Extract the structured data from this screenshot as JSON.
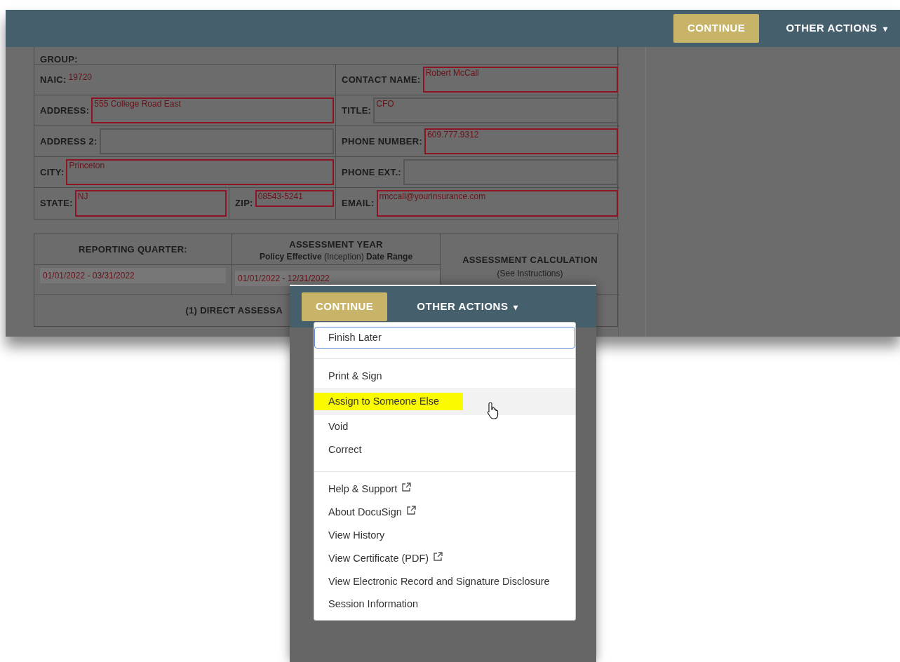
{
  "header": {
    "continue_button": "CONTINUE",
    "other_actions": "OTHER ACTIONS",
    "caret": "▾"
  },
  "contact_form": {
    "group_label": "GROUP:",
    "left": [
      {
        "kind": "text",
        "label": "NAIC:",
        "value": "19720"
      },
      {
        "kind": "field",
        "label": "ADDRESS:",
        "value": "555 College Road East",
        "required": true
      },
      {
        "kind": "field",
        "label": "ADDRESS 2:",
        "required": false
      },
      {
        "kind": "field",
        "label": "CITY:",
        "value": "Princeton",
        "required": true
      },
      {
        "kind": "pair",
        "label": "STATE:",
        "value": "NJ",
        "required": true,
        "label_2": "ZIP:",
        "value_2": "08543-5241",
        "required_2": true
      }
    ],
    "right": [
      {
        "kind": "field",
        "label": "CONTACT NAME:",
        "value": "Robert McCall",
        "required": true
      },
      {
        "kind": "field",
        "label": "TITLE:",
        "value": "CFO",
        "required": false
      },
      {
        "kind": "field",
        "label": "PHONE NUMBER:",
        "value": "609.777.9312",
        "required": true
      },
      {
        "kind": "field",
        "label": "PHONE EXT.:",
        "required": false
      },
      {
        "kind": "field",
        "label": "EMAIL:",
        "value": "rmccall@yourinsurance.com",
        "required": true
      }
    ]
  },
  "assessment": {
    "reporting_quarter": {
      "label": "REPORTING QUARTER:",
      "value": "01/01/2022 - 03/31/2022"
    },
    "assessment_year": {
      "label": "ASSESSMENT YEAR",
      "sublabel": "**Policy Effective** (Inception) **Date Range**",
      "value": "01/01/2022 - 12/31/2022"
    },
    "calculation": {
      "label": "ASSESSMENT CALCULATION",
      "sublabel": "(See Instructions)"
    },
    "direct_row": {
      "label": "(1) DIRECT ASSESSA"
    }
  },
  "panel": {
    "continue_button": "CONTINUE",
    "other_actions": "OTHER ACTIONS",
    "caret": "▾",
    "menu": [
      {
        "kind": "item",
        "label": "Finish Later",
        "focused": true,
        "highlighted": false,
        "external": false
      },
      {
        "kind": "divider"
      },
      {
        "kind": "item",
        "label": "Print & Sign",
        "focused": false,
        "highlighted": false,
        "external": false
      },
      {
        "kind": "item",
        "label": "Assign to Someone Else",
        "focused": false,
        "highlighted": true,
        "external": false
      },
      {
        "kind": "item",
        "label": "Void",
        "focused": false,
        "highlighted": false,
        "external": false
      },
      {
        "kind": "item",
        "label": "Correct",
        "focused": false,
        "highlighted": false,
        "external": false
      },
      {
        "kind": "divider"
      },
      {
        "kind": "item",
        "label": "Help & Support",
        "focused": false,
        "highlighted": false,
        "external": true
      },
      {
        "kind": "item",
        "label": "About DocuSign",
        "focused": false,
        "highlighted": false,
        "external": true
      },
      {
        "kind": "item",
        "label": "View History",
        "focused": false,
        "highlighted": false,
        "external": false
      },
      {
        "kind": "item",
        "label": "View Certificate (PDF)",
        "focused": false,
        "highlighted": false,
        "external": true
      },
      {
        "kind": "item",
        "label": "View Electronic Record and Signature Disclosure",
        "focused": false,
        "highlighted": false,
        "external": false
      },
      {
        "kind": "item",
        "label": "Session Information",
        "focused": false,
        "highlighted": false,
        "external": false
      }
    ]
  }
}
